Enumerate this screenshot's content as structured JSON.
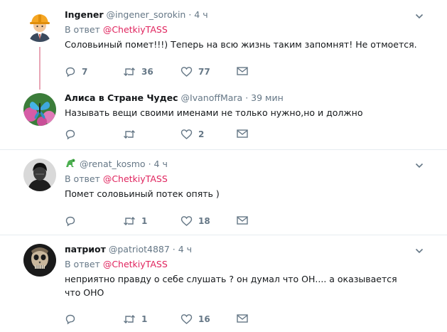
{
  "reply_prefix": "В ответ",
  "tweets": [
    {
      "name": "Ingener",
      "handle": "@ingener_sorokin",
      "time": "4 ч",
      "reply_to": "@ChetkiyTASS",
      "text": "Соловьиный помет!!!) Теперь на всю жизнь  таким запомнят! Не отмоется.",
      "replies": "7",
      "retweets": "36",
      "likes": "77"
    },
    {
      "name": "Алиса в Стране Чудес",
      "handle": "@IvanoffMara",
      "time": "39 мин",
      "text": "Называть вещи своими именами не только нужно,но и должно",
      "replies": "",
      "retweets": "",
      "likes": "2"
    },
    {
      "name": "",
      "handle": "@renat_kosmo",
      "time": "4 ч",
      "reply_to": "@ChetkiyTASS",
      "text": "Помет соловьиный потек опять )",
      "replies": "",
      "retweets": "1",
      "likes": "18"
    },
    {
      "name": "патриот",
      "handle": "@patriot4887",
      "time": "4 ч",
      "reply_to": "@ChetkiyTASS",
      "text": "неприятно правду о себе слушать ? он думал что ОН.... а оказывается что ОНО",
      "replies": "",
      "retweets": "1",
      "likes": "16"
    }
  ],
  "icons": {
    "reply": "reply-icon",
    "retweet": "retweet-icon",
    "like": "heart-icon",
    "dm": "envelope-icon",
    "more": "chevron-down-icon"
  },
  "colors": {
    "mention": "#e0245e",
    "secondary_text": "#657786",
    "thread_line": "#e8a6b6",
    "separator": "#e6ecf0"
  }
}
